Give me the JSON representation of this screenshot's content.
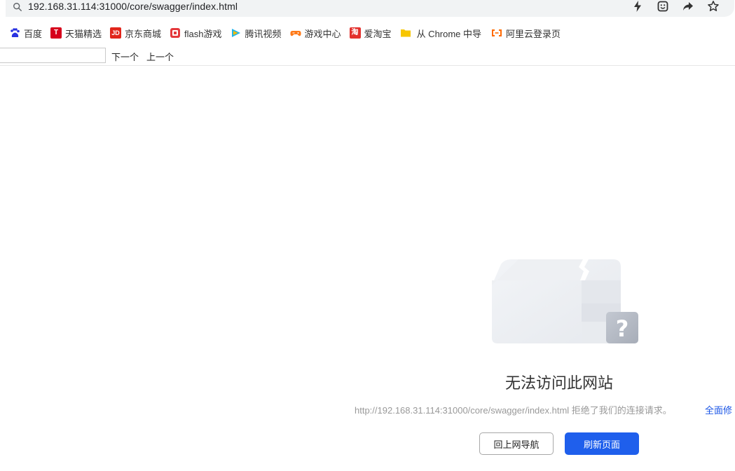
{
  "address_bar": {
    "url": "192.168.31.114:31000/core/swagger/index.html",
    "search_icon": "search-icon",
    "actions": [
      "lightning-icon",
      "emoji-icon",
      "share-icon",
      "star-icon"
    ]
  },
  "bookmarks": [
    {
      "label": "百度",
      "icon": "baidu-icon",
      "color": "#2932e1"
    },
    {
      "label": "天猫精选",
      "icon": "tmall-icon",
      "color": "#d6001c"
    },
    {
      "label": "京东商城",
      "icon": "jd-icon",
      "color": "#e1251b"
    },
    {
      "label": "flash游戏",
      "icon": "flash-game-icon",
      "color": "#e4393c"
    },
    {
      "label": "腾讯视频",
      "icon": "tencent-video-icon",
      "color": "#20b5ea"
    },
    {
      "label": "游戏中心",
      "icon": "game-center-icon",
      "color": "#ff7a18"
    },
    {
      "label": "爱淘宝",
      "icon": "taobao-icon",
      "color": "#e3312d"
    },
    {
      "label": "从 Chrome 中导",
      "icon": "folder-icon",
      "color": "#f7c600"
    },
    {
      "label": "阿里云登录页",
      "icon": "aliyun-icon",
      "color": "#ff6a00"
    }
  ],
  "find_bar": {
    "value": "",
    "next_label": "下一个",
    "prev_label": "上一个"
  },
  "error": {
    "title": "无法访问此网站",
    "description": "http://192.168.31.114:31000/core/swagger/index.html 拒绝了我们的连接请求。",
    "fix_link": "全面修",
    "home_button": "回上网导航",
    "reload_button": "刷新页面"
  }
}
